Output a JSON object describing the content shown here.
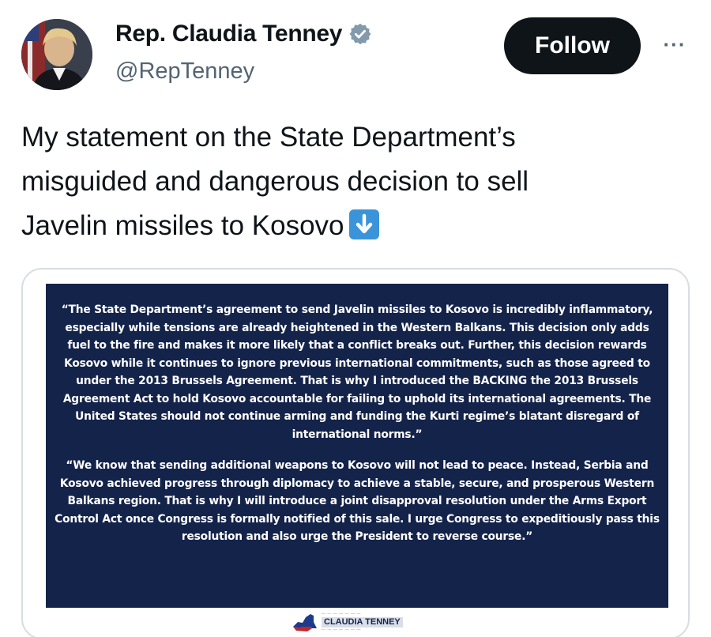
{
  "author": {
    "name": "Rep. Claudia Tenney",
    "handle": "@RepTenney",
    "verified_icon": "verified-badge-icon"
  },
  "actions": {
    "follow_label": "Follow",
    "more_label": "···"
  },
  "tweet": {
    "lines": [
      "My statement on the State Department’s",
      "misguided and dangerous decision to sell",
      "Javelin missiles to Kosovo"
    ],
    "emoji_icon": "down-arrow-emoji-icon"
  },
  "media": {
    "paragraph_1": "“The State Department’s agreement to send Javelin missiles to Kosovo is incredibly inflammatory, especially while tensions are already heightened in the Western Balkans. This decision only adds fuel to the fire and makes it more likely that a conflict breaks out. Further, this decision rewards Kosovo while it continues to ignore previous international commitments, such as those agreed to under the 2013 Brussels Agreement. That is why I introduced the BACKING the 2013 Brussels Agreement Act to hold Kosovo accountable for failing to uphold its international agreements. The United States should not continue arming and funding the Kurti regime’s blatant disregard of international norms.”",
    "paragraph_2": "“We know that sending additional weapons to Kosovo will not lead to peace. Instead, Serbia and Kosovo achieved progress through diplomacy to achieve a stable, secure, and prosperous Western Balkans region. That is why I will introduce a joint disapproval resolution under the Arms Export Control Act once Congress is formally notified of this sale. I urge Congress to expeditiously pass this resolution and also urge the President to reverse course.”",
    "logo_name": "CLAUDIA TENNEY"
  },
  "colors": {
    "statement_bg": "#14234a",
    "follow_bg": "#0f1419",
    "verified": "#829aab"
  }
}
